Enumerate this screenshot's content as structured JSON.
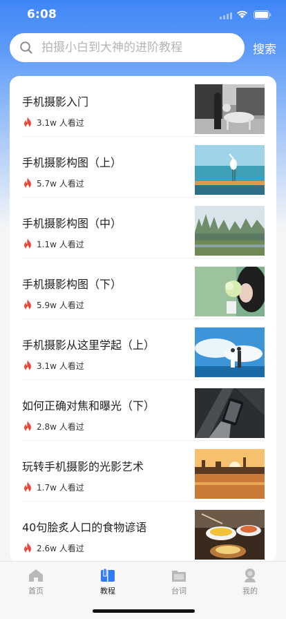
{
  "status_bar": {
    "time": "6:08"
  },
  "search": {
    "placeholder": "拍摄小白到大神的进阶教程",
    "button_label": "搜索"
  },
  "articles": [
    {
      "title": "手机摄影入门",
      "views": "3.1w 人看过",
      "thumb": "bw-street-dog"
    },
    {
      "title": "手机摄影构图（上）",
      "views": "5.7w 人看过",
      "thumb": "egret-sea"
    },
    {
      "title": "手机摄影构图（中）",
      "views": "1.1w 人看过",
      "thumb": "forest-lake"
    },
    {
      "title": "手机摄影构图（下）",
      "views": "5.9w 人看过",
      "thumb": "girl-flowers"
    },
    {
      "title": "手机摄影从这里学起（上）",
      "views": "3.1w 人看过",
      "thumb": "couple-sky"
    },
    {
      "title": "如何正确对焦和曝光（下）",
      "views": "2.8w 人看过",
      "thumb": "phone-hand-dark"
    },
    {
      "title": "玩转手机摄影的光影艺术",
      "views": "1.7w 人看过",
      "thumb": "sunset-city"
    },
    {
      "title": "40句脍炙人口的食物谚语",
      "views": "2.6w 人看过",
      "thumb": "food-table"
    }
  ],
  "tab_bar": {
    "tabs": [
      {
        "label": "首页",
        "icon": "home-icon",
        "active": false
      },
      {
        "label": "教程",
        "icon": "book-icon",
        "active": true
      },
      {
        "label": "台词",
        "icon": "folder-icon",
        "active": false
      },
      {
        "label": "我的",
        "icon": "profile-icon",
        "active": false
      }
    ]
  },
  "colors": {
    "accent": "#3f86f6",
    "fire": "#f0453a",
    "tab_active": "#2f7cf6",
    "tab_inactive": "#b9b9b9"
  }
}
